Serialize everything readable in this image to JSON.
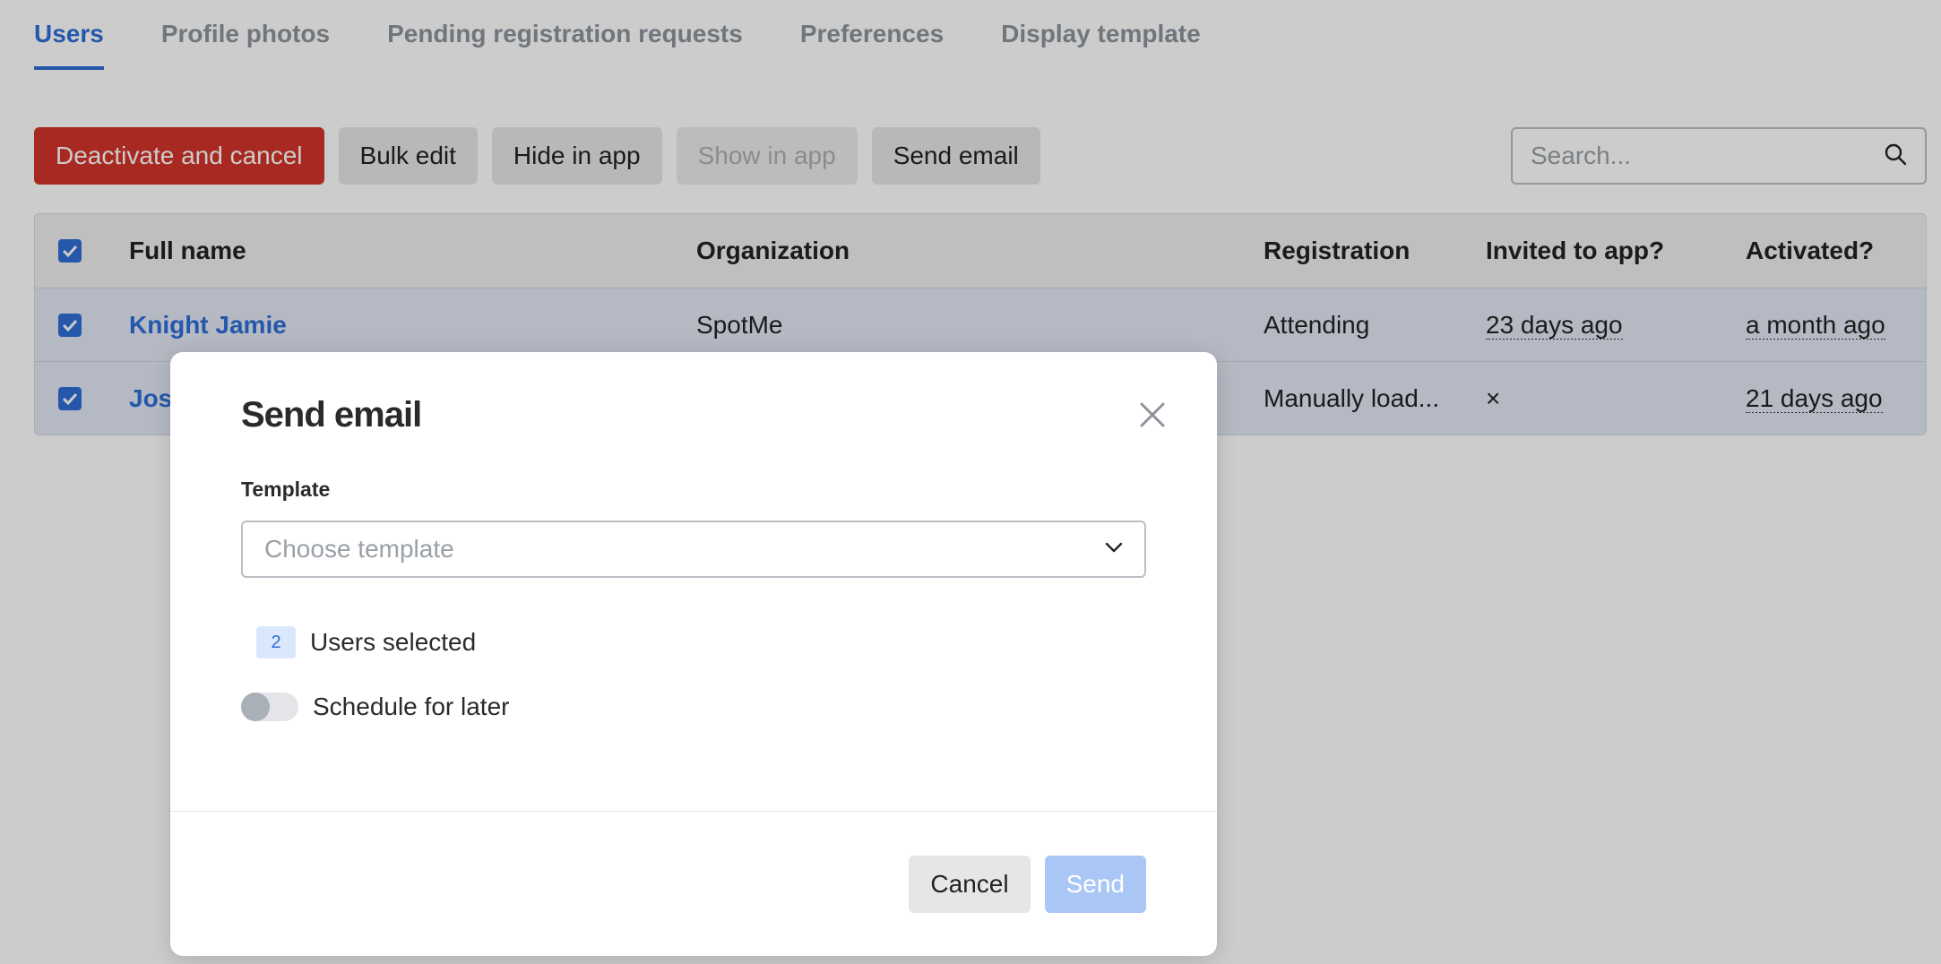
{
  "tabs": [
    {
      "label": "Users",
      "active": true
    },
    {
      "label": "Profile photos",
      "active": false
    },
    {
      "label": "Pending registration requests",
      "active": false
    },
    {
      "label": "Preferences",
      "active": false
    },
    {
      "label": "Display template",
      "active": false
    }
  ],
  "toolbar": {
    "deactivate_label": "Deactivate and cancel",
    "bulk_edit_label": "Bulk edit",
    "hide_label": "Hide in app",
    "show_label": "Show in app",
    "send_email_label": "Send email"
  },
  "search": {
    "placeholder": "Search..."
  },
  "table": {
    "columns": [
      "Full name",
      "Organization",
      "Registration",
      "Invited to app?",
      "Activated?"
    ],
    "rows": [
      {
        "name": "Knight Jamie",
        "organization": "SpotMe",
        "registration": "Attending",
        "invited": "23 days ago",
        "activated": "a month ago"
      },
      {
        "name": "Jos",
        "organization": "",
        "registration": "Manually load...",
        "invited": "×",
        "activated": "21 days ago"
      }
    ]
  },
  "modal": {
    "title": "Send email",
    "template_label": "Template",
    "template_placeholder": "Choose template",
    "selected_count": "2",
    "selected_text": "Users selected",
    "schedule_text": "Schedule for later",
    "schedule_enabled": false,
    "cancel_label": "Cancel",
    "send_label": "Send"
  },
  "colors": {
    "accent": "#2f6fd6",
    "danger": "#d3342a",
    "send_disabled": "#a9c6f5"
  },
  "icons": {
    "search": "search-icon",
    "close": "close-icon",
    "dropdown": "chevron-down-icon",
    "checkbox": "checkmark-icon"
  }
}
